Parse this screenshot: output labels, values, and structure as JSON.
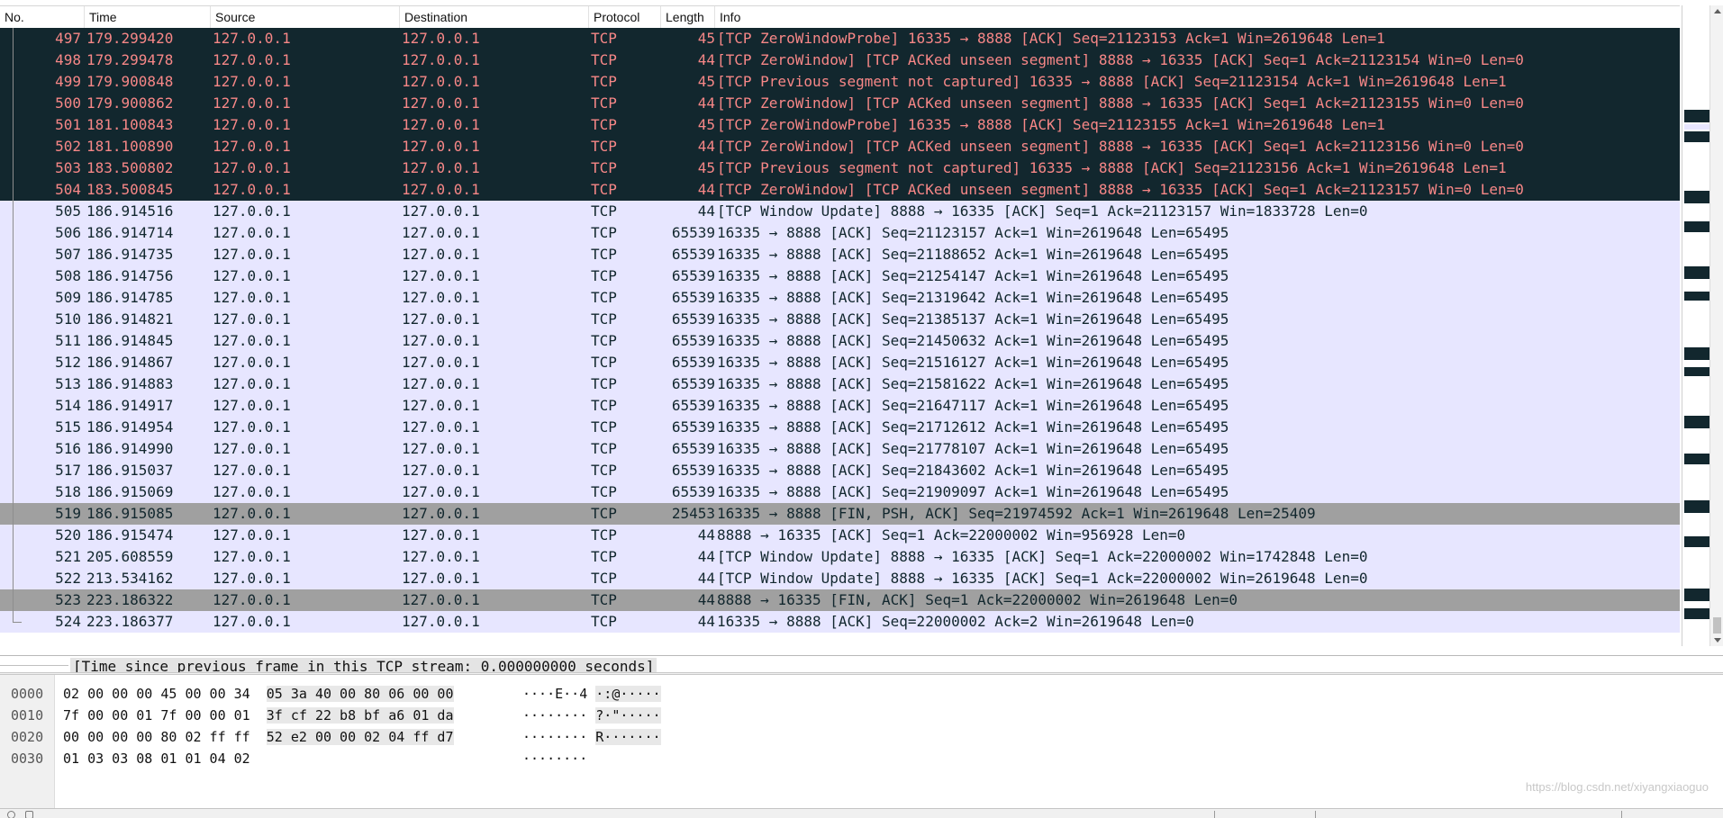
{
  "columns": {
    "no": "No.",
    "time": "Time",
    "source": "Source",
    "destination": "Destination",
    "protocol": "Protocol",
    "length": "Length",
    "info": "Info"
  },
  "packets": [
    {
      "no": "497",
      "time": "179.299420",
      "src": "127.0.0.1",
      "dst": "127.0.0.1",
      "proto": "TCP",
      "len": "45",
      "info": "[TCP ZeroWindowProbe] 16335 → 8888 [ACK] Seq=21123153 Ack=1 Win=2619648 Len=1",
      "style": "bad"
    },
    {
      "no": "498",
      "time": "179.299478",
      "src": "127.0.0.1",
      "dst": "127.0.0.1",
      "proto": "TCP",
      "len": "44",
      "info": "[TCP ZeroWindow] [TCP ACKed unseen segment] 8888 → 16335 [ACK] Seq=1 Ack=21123154 Win=0 Len=0",
      "style": "bad"
    },
    {
      "no": "499",
      "time": "179.900848",
      "src": "127.0.0.1",
      "dst": "127.0.0.1",
      "proto": "TCP",
      "len": "45",
      "info": "[TCP Previous segment not captured] 16335 → 8888 [ACK] Seq=21123154 Ack=1 Win=2619648 Len=1",
      "style": "bad"
    },
    {
      "no": "500",
      "time": "179.900862",
      "src": "127.0.0.1",
      "dst": "127.0.0.1",
      "proto": "TCP",
      "len": "44",
      "info": "[TCP ZeroWindow] [TCP ACKed unseen segment] 8888 → 16335 [ACK] Seq=1 Ack=21123155 Win=0 Len=0",
      "style": "bad"
    },
    {
      "no": "501",
      "time": "181.100843",
      "src": "127.0.0.1",
      "dst": "127.0.0.1",
      "proto": "TCP",
      "len": "45",
      "info": "[TCP ZeroWindowProbe] 16335 → 8888 [ACK] Seq=21123155 Ack=1 Win=2619648 Len=1",
      "style": "bad"
    },
    {
      "no": "502",
      "time": "181.100890",
      "src": "127.0.0.1",
      "dst": "127.0.0.1",
      "proto": "TCP",
      "len": "44",
      "info": "[TCP ZeroWindow] [TCP ACKed unseen segment] 8888 → 16335 [ACK] Seq=1 Ack=21123156 Win=0 Len=0",
      "style": "bad"
    },
    {
      "no": "503",
      "time": "183.500802",
      "src": "127.0.0.1",
      "dst": "127.0.0.1",
      "proto": "TCP",
      "len": "45",
      "info": "[TCP Previous segment not captured] 16335 → 8888 [ACK] Seq=21123156 Ack=1 Win=2619648 Len=1",
      "style": "bad"
    },
    {
      "no": "504",
      "time": "183.500845",
      "src": "127.0.0.1",
      "dst": "127.0.0.1",
      "proto": "TCP",
      "len": "44",
      "info": "[TCP ZeroWindow] [TCP ACKed unseen segment] 8888 → 16335 [ACK] Seq=1 Ack=21123157 Win=0 Len=0",
      "style": "bad"
    },
    {
      "no": "505",
      "time": "186.914516",
      "src": "127.0.0.1",
      "dst": "127.0.0.1",
      "proto": "TCP",
      "len": "44",
      "info": "[TCP Window Update] 8888 → 16335 [ACK] Seq=1 Ack=21123157 Win=1833728 Len=0",
      "style": "normal"
    },
    {
      "no": "506",
      "time": "186.914714",
      "src": "127.0.0.1",
      "dst": "127.0.0.1",
      "proto": "TCP",
      "len": "65539",
      "info": "16335 → 8888 [ACK] Seq=21123157 Ack=1 Win=2619648 Len=65495",
      "style": "normal"
    },
    {
      "no": "507",
      "time": "186.914735",
      "src": "127.0.0.1",
      "dst": "127.0.0.1",
      "proto": "TCP",
      "len": "65539",
      "info": "16335 → 8888 [ACK] Seq=21188652 Ack=1 Win=2619648 Len=65495",
      "style": "normal"
    },
    {
      "no": "508",
      "time": "186.914756",
      "src": "127.0.0.1",
      "dst": "127.0.0.1",
      "proto": "TCP",
      "len": "65539",
      "info": "16335 → 8888 [ACK] Seq=21254147 Ack=1 Win=2619648 Len=65495",
      "style": "normal"
    },
    {
      "no": "509",
      "time": "186.914785",
      "src": "127.0.0.1",
      "dst": "127.0.0.1",
      "proto": "TCP",
      "len": "65539",
      "info": "16335 → 8888 [ACK] Seq=21319642 Ack=1 Win=2619648 Len=65495",
      "style": "normal"
    },
    {
      "no": "510",
      "time": "186.914821",
      "src": "127.0.0.1",
      "dst": "127.0.0.1",
      "proto": "TCP",
      "len": "65539",
      "info": "16335 → 8888 [ACK] Seq=21385137 Ack=1 Win=2619648 Len=65495",
      "style": "normal"
    },
    {
      "no": "511",
      "time": "186.914845",
      "src": "127.0.0.1",
      "dst": "127.0.0.1",
      "proto": "TCP",
      "len": "65539",
      "info": "16335 → 8888 [ACK] Seq=21450632 Ack=1 Win=2619648 Len=65495",
      "style": "normal"
    },
    {
      "no": "512",
      "time": "186.914867",
      "src": "127.0.0.1",
      "dst": "127.0.0.1",
      "proto": "TCP",
      "len": "65539",
      "info": "16335 → 8888 [ACK] Seq=21516127 Ack=1 Win=2619648 Len=65495",
      "style": "normal"
    },
    {
      "no": "513",
      "time": "186.914883",
      "src": "127.0.0.1",
      "dst": "127.0.0.1",
      "proto": "TCP",
      "len": "65539",
      "info": "16335 → 8888 [ACK] Seq=21581622 Ack=1 Win=2619648 Len=65495",
      "style": "normal"
    },
    {
      "no": "514",
      "time": "186.914917",
      "src": "127.0.0.1",
      "dst": "127.0.0.1",
      "proto": "TCP",
      "len": "65539",
      "info": "16335 → 8888 [ACK] Seq=21647117 Ack=1 Win=2619648 Len=65495",
      "style": "normal"
    },
    {
      "no": "515",
      "time": "186.914954",
      "src": "127.0.0.1",
      "dst": "127.0.0.1",
      "proto": "TCP",
      "len": "65539",
      "info": "16335 → 8888 [ACK] Seq=21712612 Ack=1 Win=2619648 Len=65495",
      "style": "normal"
    },
    {
      "no": "516",
      "time": "186.914990",
      "src": "127.0.0.1",
      "dst": "127.0.0.1",
      "proto": "TCP",
      "len": "65539",
      "info": "16335 → 8888 [ACK] Seq=21778107 Ack=1 Win=2619648 Len=65495",
      "style": "normal"
    },
    {
      "no": "517",
      "time": "186.915037",
      "src": "127.0.0.1",
      "dst": "127.0.0.1",
      "proto": "TCP",
      "len": "65539",
      "info": "16335 → 8888 [ACK] Seq=21843602 Ack=1 Win=2619648 Len=65495",
      "style": "normal"
    },
    {
      "no": "518",
      "time": "186.915069",
      "src": "127.0.0.1",
      "dst": "127.0.0.1",
      "proto": "TCP",
      "len": "65539",
      "info": "16335 → 8888 [ACK] Seq=21909097 Ack=1 Win=2619648 Len=65495",
      "style": "normal"
    },
    {
      "no": "519",
      "time": "186.915085",
      "src": "127.0.0.1",
      "dst": "127.0.0.1",
      "proto": "TCP",
      "len": "25453",
      "info": "16335 → 8888 [FIN, PSH, ACK] Seq=21974592 Ack=1 Win=2619648 Len=25409",
      "style": "fin"
    },
    {
      "no": "520",
      "time": "186.915474",
      "src": "127.0.0.1",
      "dst": "127.0.0.1",
      "proto": "TCP",
      "len": "44",
      "info": "8888 → 16335 [ACK] Seq=1 Ack=22000002 Win=956928 Len=0",
      "style": "normal"
    },
    {
      "no": "521",
      "time": "205.608559",
      "src": "127.0.0.1",
      "dst": "127.0.0.1",
      "proto": "TCP",
      "len": "44",
      "info": "[TCP Window Update] 8888 → 16335 [ACK] Seq=1 Ack=22000002 Win=1742848 Len=0",
      "style": "normal"
    },
    {
      "no": "522",
      "time": "213.534162",
      "src": "127.0.0.1",
      "dst": "127.0.0.1",
      "proto": "TCP",
      "len": "44",
      "info": "[TCP Window Update] 8888 → 16335 [ACK] Seq=1 Ack=22000002 Win=2619648 Len=0",
      "style": "normal"
    },
    {
      "no": "523",
      "time": "223.186322",
      "src": "127.0.0.1",
      "dst": "127.0.0.1",
      "proto": "TCP",
      "len": "44",
      "info": "8888 → 16335 [FIN, ACK] Seq=1 Ack=22000002 Win=2619648 Len=0",
      "style": "fin"
    },
    {
      "no": "524",
      "time": "223.186377",
      "src": "127.0.0.1",
      "dst": "127.0.0.1",
      "proto": "TCP",
      "len": "44",
      "info": "16335 → 8888 [ACK] Seq=22000002 Ack=2 Win=2619648 Len=0",
      "style": "normal"
    }
  ],
  "detail": {
    "text": "[Time since previous frame in this TCP stream: 0.000000000 seconds]"
  },
  "bytes": [
    {
      "offset": "0000",
      "hex_a": "02 00 00 00 45 00 00 34",
      "hex_b": "05 3a 40 00 80 06 00 00",
      "ascii_a": "····E··4",
      "ascii_b": "·:@·····"
    },
    {
      "offset": "0010",
      "hex_a": "7f 00 00 01 7f 00 00 01",
      "hex_b": "3f cf 22 b8 bf a6 01 da",
      "ascii_a": "········",
      "ascii_b": "?·\"·····"
    },
    {
      "offset": "0020",
      "hex_a": "00 00 00 00 80 02 ff ff",
      "hex_b": "52 e2 00 00 02 04 ff d7",
      "ascii_a": "········",
      "ascii_b": "R·······"
    },
    {
      "offset": "0030",
      "hex_a": "01 03 03 08 01 01 04 02",
      "hex_b": "",
      "ascii_a": "········",
      "ascii_b": ""
    }
  ],
  "watermark": "https://blog.csdn.net/xiyangxiaoguo",
  "colors": {
    "bad_row_bg": "#12272e",
    "bad_row_fg": "#f78787",
    "normal_row_bg": "#e7e6ff",
    "fin_row_bg": "#a0a0a0"
  }
}
